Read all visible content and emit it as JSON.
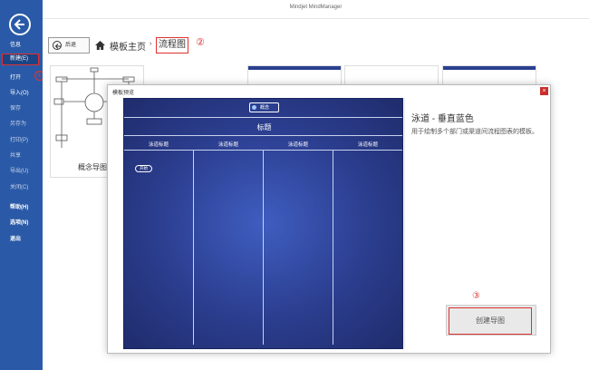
{
  "window": {
    "title": "Mindjet MindManager"
  },
  "sidebar": {
    "items": [
      {
        "label": "信息"
      },
      {
        "label": "新建(E)"
      },
      {
        "label": "打开"
      },
      {
        "label": "导入(O)"
      },
      {
        "label": "保存"
      },
      {
        "label": "另存为"
      },
      {
        "label": "打印(P)"
      },
      {
        "label": "共享"
      },
      {
        "label": "导出(U)"
      },
      {
        "label": "关闭(C)"
      },
      {
        "label": "帮助(H)"
      },
      {
        "label": "选项(N)"
      },
      {
        "label": "退出"
      }
    ],
    "marker": "①"
  },
  "header": {
    "back_label": "后退",
    "breadcrumb_home": "模板主页",
    "breadcrumb_sep": "›",
    "breadcrumb_current": "流程图",
    "marker": "②"
  },
  "thumbnails": [
    {
      "label": "概念导图"
    }
  ],
  "dialog": {
    "title": "模板预览",
    "close": "×",
    "preview": {
      "topic_label": "概念",
      "title": "标题",
      "lanes": [
        "泳道标题",
        "泳道标题",
        "泳道标题",
        "泳道标题"
      ],
      "start_label": "开始"
    },
    "template_name": "泳道 - 垂直蓝色",
    "template_desc": "用于绘制多个部门或渠道间流程图表的模板。",
    "create_label": "创建导图",
    "marker": "③"
  },
  "colors": {
    "sidebar": "#2a5aa7",
    "highlight": "#e03030",
    "preview_bg": "#2b3d8e"
  }
}
